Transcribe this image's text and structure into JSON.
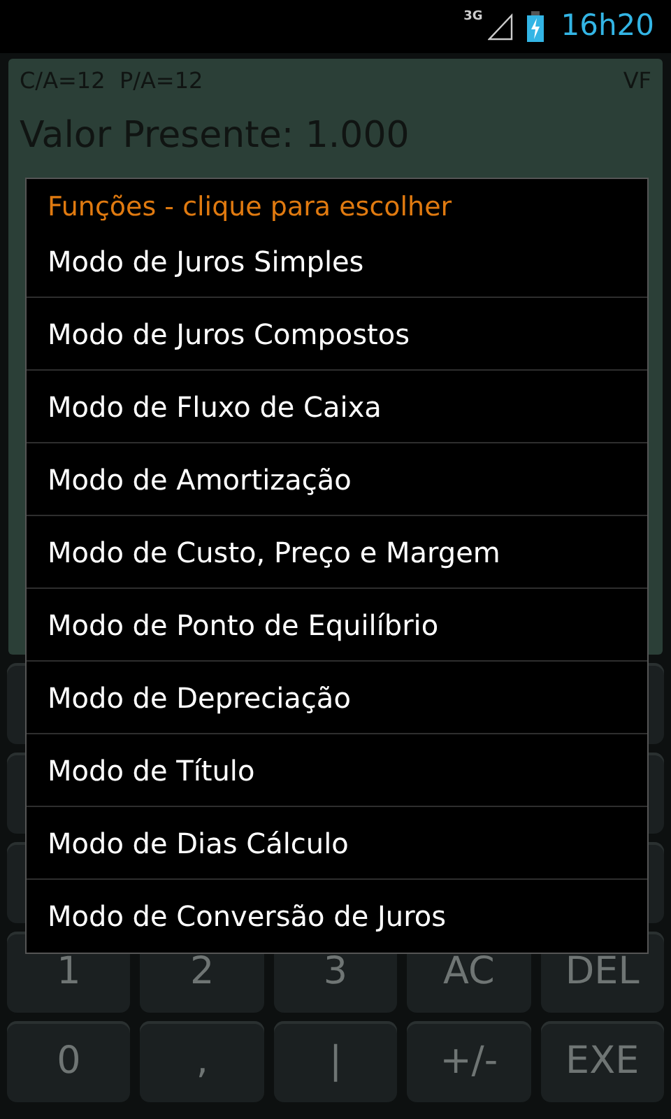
{
  "status_bar": {
    "network": "3G",
    "time": "16h20"
  },
  "display": {
    "settings": "C/A=12  P/A=12",
    "mode": "VF",
    "value": "Valor Presente: 1.000"
  },
  "keypad": {
    "rows": [
      [
        "1",
        "2",
        "3",
        "AC",
        "DEL"
      ],
      [
        "0",
        ",",
        "|",
        "+/-",
        "EXE"
      ]
    ]
  },
  "dialog": {
    "title": "Funções - clique para escolher",
    "items": [
      {
        "label": "Modo de Juros Simples"
      },
      {
        "label": "Modo de Juros Compostos"
      },
      {
        "label": "Modo de Fluxo de Caixa"
      },
      {
        "label": "Modo de Amortização"
      },
      {
        "label": "Modo de Custo, Preço e Margem"
      },
      {
        "label": "Modo de Ponto de Equilíbrio"
      },
      {
        "label": "Modo de Depreciação"
      },
      {
        "label": "Modo de Título"
      },
      {
        "label": "Modo de Dias Cálculo"
      },
      {
        "label": "Modo de Conversão de Juros"
      }
    ]
  }
}
